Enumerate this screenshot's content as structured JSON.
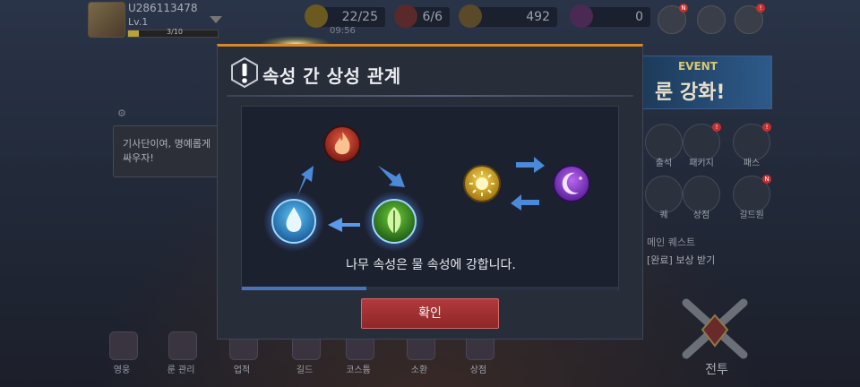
{
  "player": {
    "uid": "U286113478",
    "level": "Lv.1",
    "xp": "3/10"
  },
  "resources": [
    {
      "name": "stamina",
      "value": "22/25",
      "icon": "lightning-icon",
      "color": "#d9b23a"
    },
    {
      "name": "tickets",
      "value": "6/6",
      "icon": "crossed-swords-ticket-icon",
      "color": "#c04040"
    },
    {
      "name": "gold",
      "value": "492",
      "icon": "coin-icon",
      "color": "#c9a23a"
    },
    {
      "name": "gems",
      "value": "0",
      "icon": "gem-icon",
      "color": "#b04fc0"
    }
  ],
  "timer": "09:56",
  "event_banner": {
    "label": "EVENT",
    "text": "룬 강화!"
  },
  "notice": {
    "text": "기사단이여, 명예롭게 싸우자!"
  },
  "right_menu": [
    {
      "label": "출석"
    },
    {
      "label": "패키지"
    },
    {
      "label": "패스"
    },
    {
      "label": "퀘"
    },
    {
      "label": "상점"
    },
    {
      "label": "길드원"
    }
  ],
  "quest": {
    "title": "메인 퀘스트",
    "status": "[완료] 보상 받기"
  },
  "battle_label": "전투",
  "bottom_nav": [
    "영웅",
    "룬 관리",
    "업적",
    "길드",
    "코스튬",
    "소환",
    "상점"
  ],
  "modal": {
    "title": "속성 간 상성 관계",
    "description": "나무 속성은 물 속성에 강합니다.",
    "confirm_label": "확인",
    "progress": 0.33,
    "accent_color": "#d6882a",
    "elements": [
      "fire",
      "water",
      "wood",
      "light",
      "dark"
    ],
    "highlighted": [
      "water",
      "wood"
    ]
  }
}
